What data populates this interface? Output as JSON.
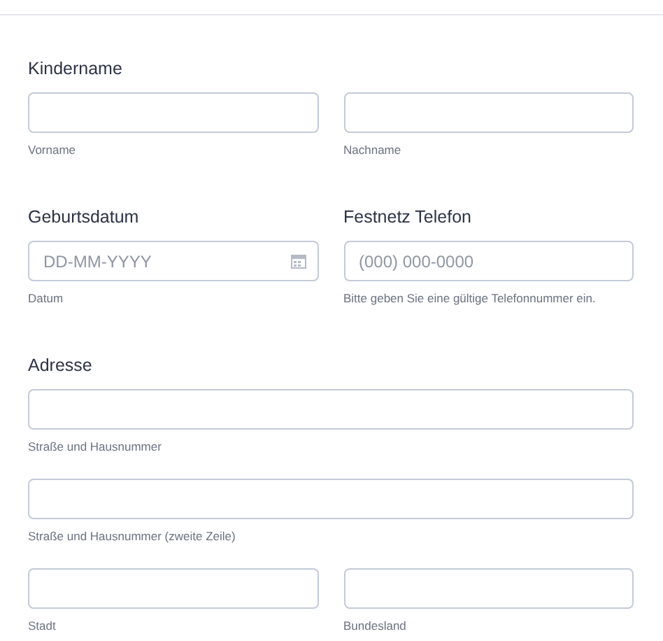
{
  "form": [
    {
      "columns": [
        {
          "label": "Kindername",
          "lines": [
            [
              {
                "kind": "text",
                "sublabel": "Vorname"
              },
              {
                "kind": "text",
                "sublabel": "Nachname"
              }
            ]
          ]
        }
      ]
    },
    {
      "columns": [
        {
          "label": "Geburtsdatum",
          "lines": [
            [
              {
                "kind": "date",
                "placeholder": "DD-MM-YYYY",
                "sublabel": "Datum"
              }
            ]
          ]
        },
        {
          "label": "Festnetz Telefon",
          "lines": [
            [
              {
                "kind": "text",
                "placeholder": "(000) 000-0000",
                "sublabel": "Bitte geben Sie eine gültige Telefonnummer ein."
              }
            ]
          ]
        }
      ]
    },
    {
      "columns": [
        {
          "label": "Adresse",
          "lines": [
            [
              {
                "kind": "text",
                "sublabel": "Straße und Hausnummer"
              }
            ],
            [
              {
                "kind": "text",
                "sublabel": "Straße und Hausnummer (zweite Zeile)"
              }
            ],
            [
              {
                "kind": "text",
                "sublabel": "Stadt"
              },
              {
                "kind": "text",
                "sublabel": "Bundesland"
              }
            ]
          ]
        }
      ]
    }
  ]
}
